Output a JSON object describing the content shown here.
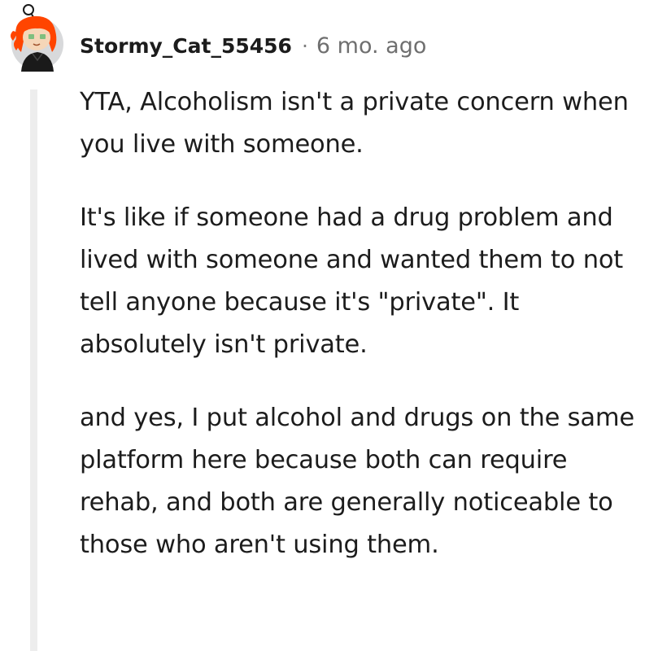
{
  "comment": {
    "author": "Stormy_Cat_55456",
    "separator": "·",
    "timestamp": "6 mo. ago",
    "paragraphs": [
      "YTA, Alcoholism isn't a private concern when you live with someone.",
      "It's like if someone had a drug problem and lived with someone and wanted them to not tell anyone because it's \"private\". It absolutely isn't private.",
      "and yes, I put alcohol and drugs on the same platform here because both can require rehab, and both are generally noticeable to those who aren't using them."
    ]
  },
  "colors": {
    "avatar_background": "#d8d9db",
    "hair": "#ff4500",
    "skin": "#f5d6b8",
    "eyes": "#7fbf7f",
    "shirt": "#1a1a1a",
    "thread_line": "#ededed",
    "meta_text": "#6f6f6f"
  }
}
